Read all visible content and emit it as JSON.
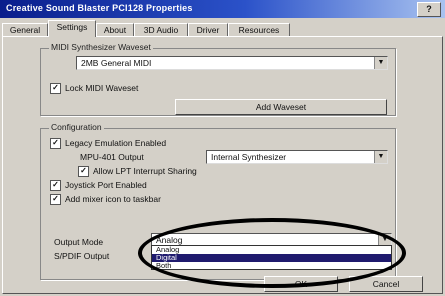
{
  "window": {
    "title": "Creative Sound Blaster PCI128 Properties",
    "help_label": "?"
  },
  "tabs": [
    {
      "label": "General"
    },
    {
      "label": "Settings"
    },
    {
      "label": "About"
    },
    {
      "label": "3D Audio"
    },
    {
      "label": "Driver"
    },
    {
      "label": "Resources"
    }
  ],
  "midi_group": {
    "label": "MIDI Synthesizer Waveset",
    "waveset_value": "2MB General MIDI",
    "lock_label": "Lock MIDI Waveset",
    "lock_checked": "✓",
    "add_button": "Add Waveset"
  },
  "config_group": {
    "label": "Configuration",
    "legacy_label": "Legacy Emulation Enabled",
    "legacy_checked": "✓",
    "mpu_label": "MPU-401 Output",
    "mpu_value": "Internal Synthesizer",
    "lpt_label": "Allow LPT Interrupt Sharing",
    "lpt_checked": "✓",
    "joystick_label": "Joystick Port Enabled",
    "joystick_checked": "✓",
    "taskbar_label": "Add mixer icon to taskbar",
    "taskbar_checked": "✓",
    "output_mode_label": "Output Mode",
    "output_mode_value": "Analog",
    "spdif_label": "S/PDIF Output",
    "dropdown_options": [
      "Analog",
      "Digital",
      "Both"
    ],
    "selected_option_index": 1
  },
  "footer": {
    "ok_label": "OK",
    "cancel_label": "Cancel"
  },
  "colors": {
    "titlebar_start": "#0a1e8c",
    "selection": "#1f1a6e",
    "face": "#d4d0c8"
  }
}
